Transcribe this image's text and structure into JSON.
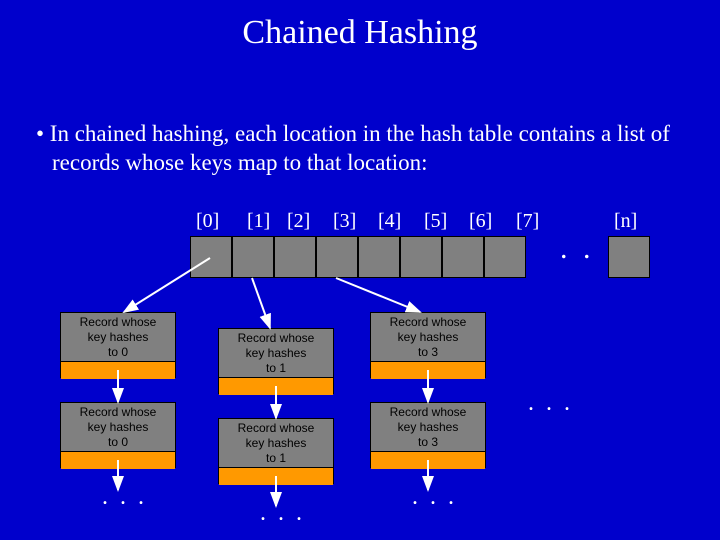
{
  "title": "Chained Hashing",
  "bullet": "• In chained hashing, each location in the hash table contains a list of records whose keys map to that location:",
  "indices": [
    "[0]",
    "[1]",
    "[2]",
    "[3]",
    "[4]",
    "[5]",
    "[6]",
    "[7]",
    "[n]"
  ],
  "records": {
    "c0r0": {
      "l1": "Record whose",
      "l2": "key hashes",
      "l3": "to 0"
    },
    "c0r1": {
      "l1": "Record whose",
      "l2": "key hashes",
      "l3": "to 0"
    },
    "c1r0": {
      "l1": "Record whose",
      "l2": "key hashes",
      "l3": "to 1"
    },
    "c1r1": {
      "l1": "Record whose",
      "l2": "key hashes",
      "l3": "to 1"
    },
    "c3r0": {
      "l1": "Record whose",
      "l2": "key hashes",
      "l3": "to 3"
    },
    "c3r1": {
      "l1": "Record whose",
      "l2": "key hashes",
      "l3": "to 3"
    }
  },
  "dots": ". . ."
}
